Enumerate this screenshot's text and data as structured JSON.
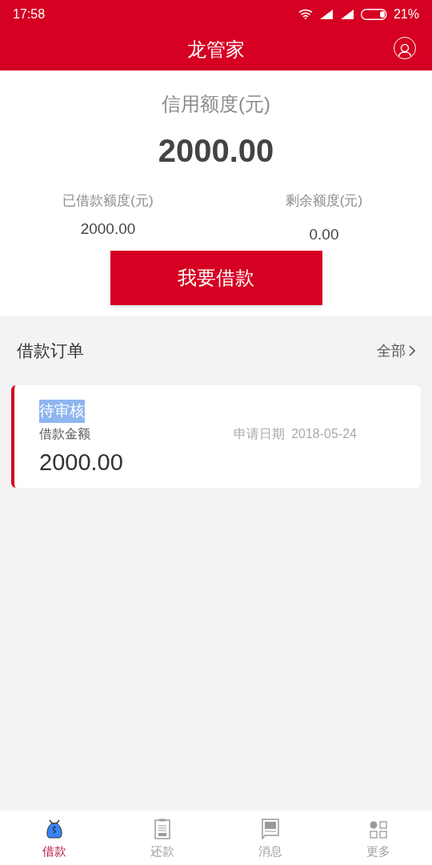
{
  "status_bar": {
    "time": "17:58",
    "battery": "21%"
  },
  "header": {
    "title": "龙管家"
  },
  "credit": {
    "label": "信用额度(元)",
    "amount": "2000.00",
    "stats": [
      {
        "label": "已借款额度(元)",
        "value": "2000.00"
      },
      {
        "label": "剩余额度(元)",
        "value": "0.00"
      }
    ],
    "button": "我要借款"
  },
  "orders_section": {
    "title": "借款订单",
    "link": "全部",
    "orders": [
      {
        "status": "待审核",
        "highlighted": true,
        "amount_label": "借款金额",
        "amount": "2000.00",
        "date_label": "申请日期",
        "date": "2018-05-24"
      }
    ]
  },
  "tab_bar": [
    {
      "label": "借款",
      "selected": true
    },
    {
      "label": "还款",
      "selected": false
    },
    {
      "label": "消息",
      "selected": false
    },
    {
      "label": "更多",
      "selected": false
    }
  ]
}
